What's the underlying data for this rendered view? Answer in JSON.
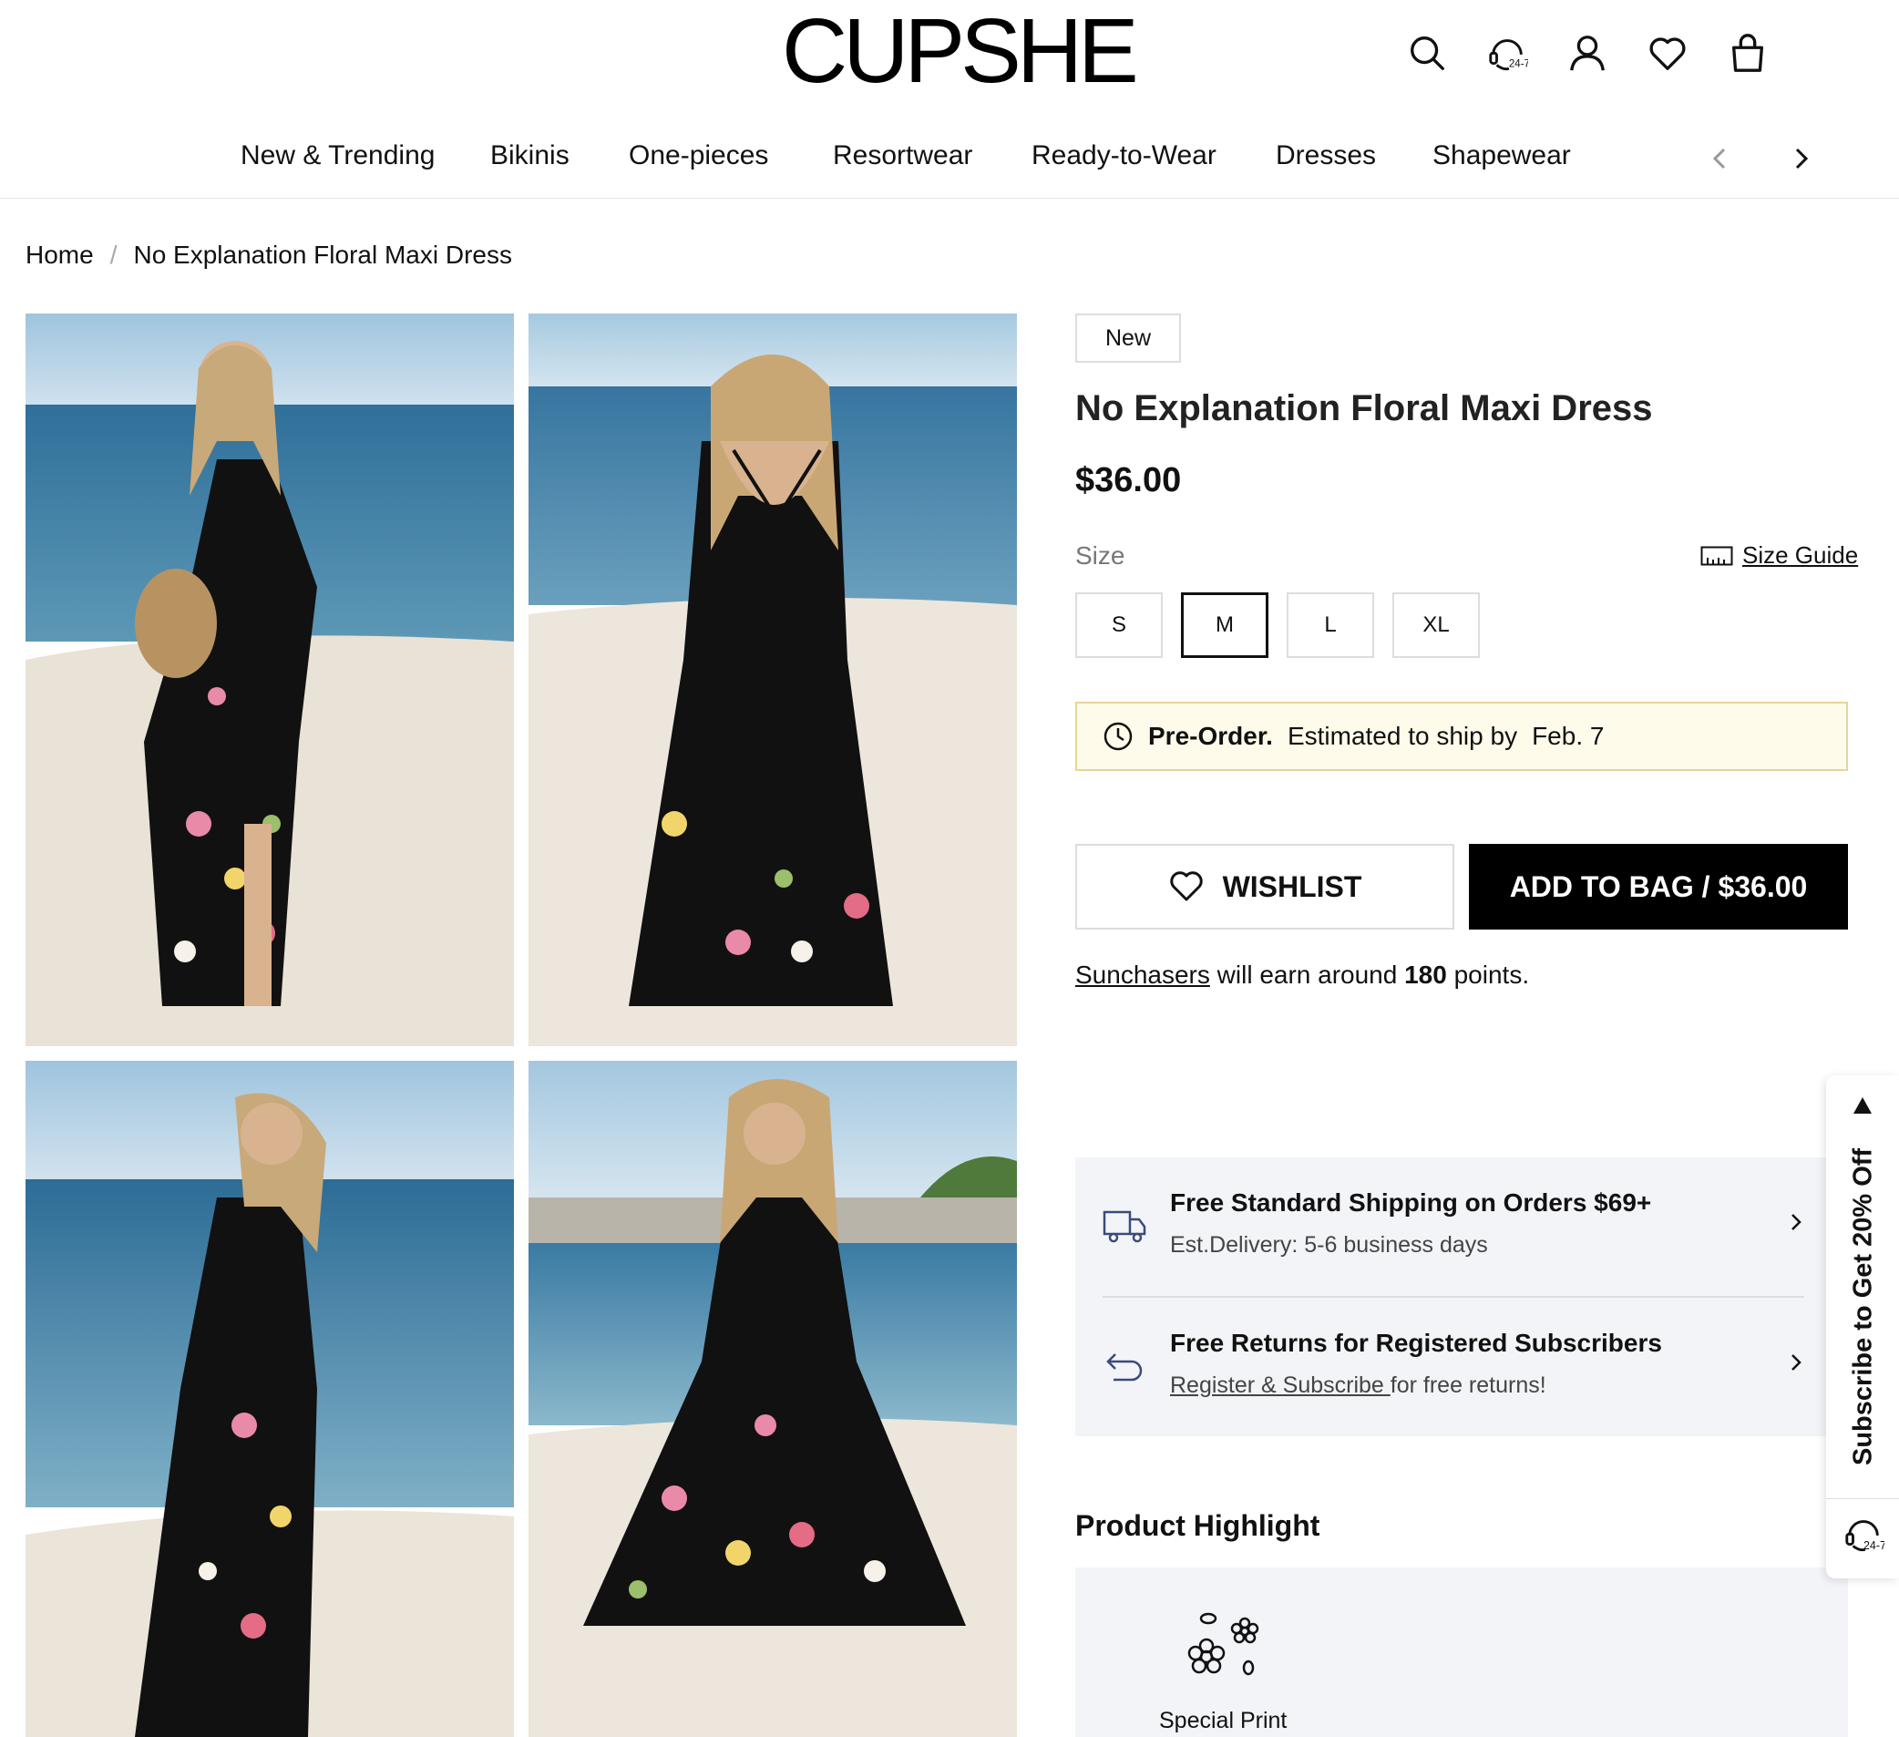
{
  "brand": {
    "logo_text": "CUPSHE"
  },
  "header_icons": [
    {
      "name": "search-icon"
    },
    {
      "name": "support-24-7-icon",
      "label": "24-7"
    },
    {
      "name": "account-icon"
    },
    {
      "name": "wishlist-heart-icon"
    },
    {
      "name": "shopping-bag-icon"
    }
  ],
  "nav": {
    "items": [
      "New & Trending",
      "Bikinis",
      "One-pieces",
      "Resortwear",
      "Ready-to-Wear",
      "Dresses",
      "Shapewear"
    ],
    "prev_icon": "chevron-left-icon",
    "next_icon": "chevron-right-icon"
  },
  "breadcrumb": {
    "home": "Home",
    "separator": "/",
    "current": "No Explanation Floral Maxi Dress"
  },
  "product": {
    "badge": "New",
    "title": "No Explanation Floral Maxi Dress",
    "price": "$36.00",
    "size_label": "Size",
    "size_guide": "Size Guide",
    "sizes": [
      "S",
      "M",
      "L",
      "XL"
    ],
    "selected_size": "M",
    "preorder_label": "Pre-Order.",
    "preorder_text": "Estimated to ship by",
    "preorder_date": "Feb. 7",
    "wishlist_label": "WISHLIST",
    "add_to_bag_label": "ADD TO BAG / $36.00",
    "points_link": "Sunchasers",
    "points_text_1": "will earn around",
    "points_value": "180",
    "points_text_2": "points."
  },
  "shipping": {
    "shipping_title": "Free Standard Shipping on Orders $69+",
    "shipping_sub": "Est.Delivery: 5-6 business days",
    "returns_title": "Free Returns for Registered Subscribers",
    "returns_link": "Register & Subscribe ",
    "returns_sub": "for free returns!"
  },
  "highlight": {
    "title": "Product Highlight",
    "item_label": "Special Print",
    "item_icon": "floral-print-icon"
  },
  "side_tab": {
    "text": "Subscribe to Get 20% Off",
    "support_label": "24-7"
  },
  "colors": {
    "accent": "#000000",
    "preorder_bg": "#fffbea",
    "preorder_border": "#e6d59a",
    "panel_bg": "#f3f4f7"
  }
}
